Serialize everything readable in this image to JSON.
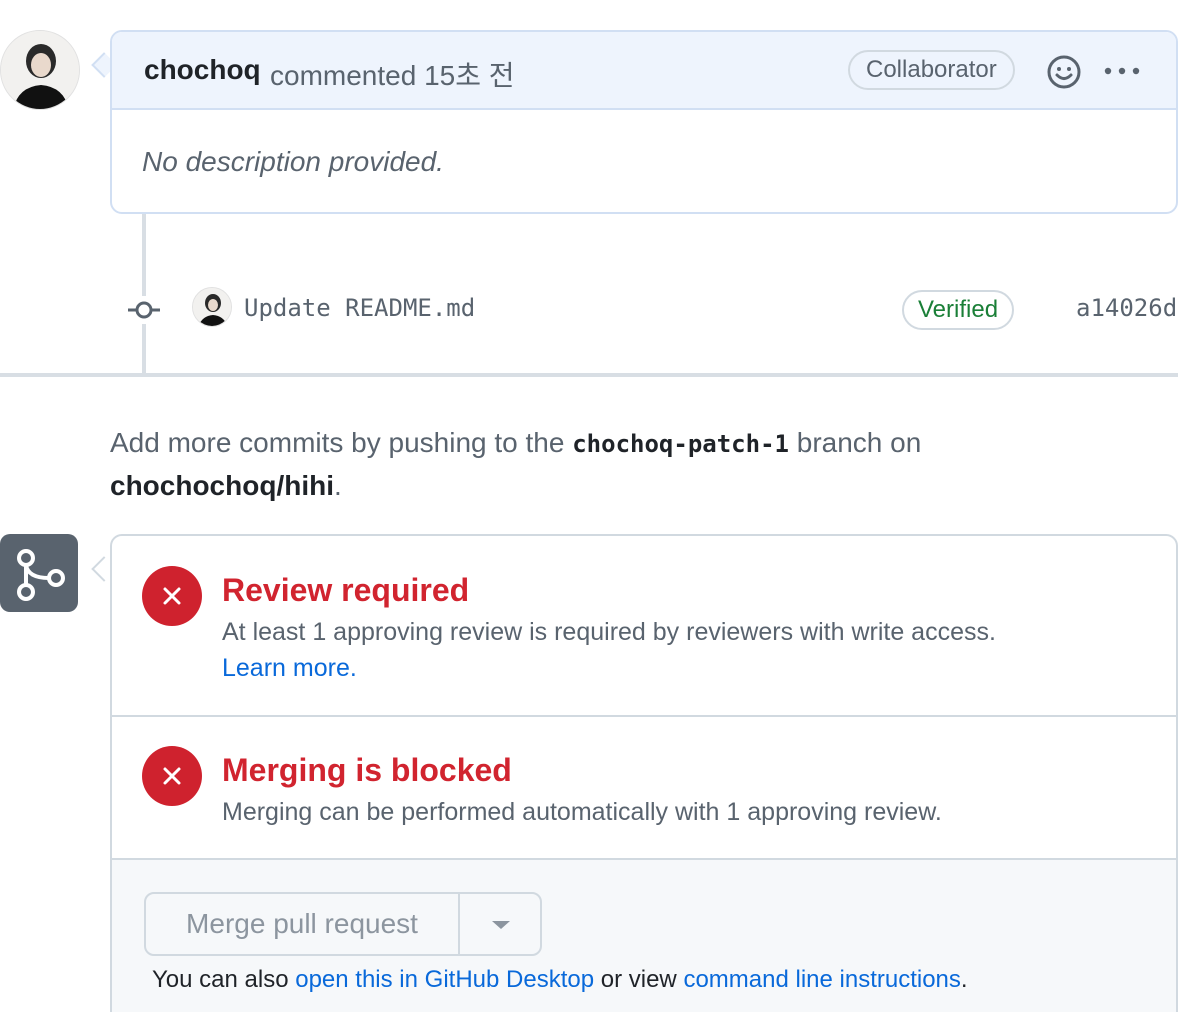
{
  "comment": {
    "author": "chochoq",
    "meta": "commented 15초 전",
    "role_badge": "Collaborator",
    "body": "No description provided."
  },
  "commit": {
    "message": "Update README.md",
    "verified_label": "Verified",
    "sha": "a14026d"
  },
  "push_info": {
    "prefix": "Add more commits by pushing to the",
    "branch": "chochoq-patch-1",
    "middle": "branch on",
    "repo": "chochochoq/hihi",
    "suffix": "."
  },
  "merge_status": {
    "review": {
      "title": "Review required",
      "description": "At least 1 approving review is required by reviewers with write access.",
      "link": "Learn more."
    },
    "blocked": {
      "title": "Merging is blocked",
      "description": "Merging can be performed automatically with 1 approving review."
    },
    "merge_button_label": "Merge pull request",
    "also": {
      "prefix": "You can also",
      "desktop_link": "open this in GitHub Desktop",
      "middle": "or view",
      "cli_link": "command line instructions",
      "suffix": "."
    }
  },
  "colors": {
    "danger": "#cf222e",
    "success": "#1a7f37",
    "link": "#0969da",
    "header_bg": "#eef4fd"
  }
}
